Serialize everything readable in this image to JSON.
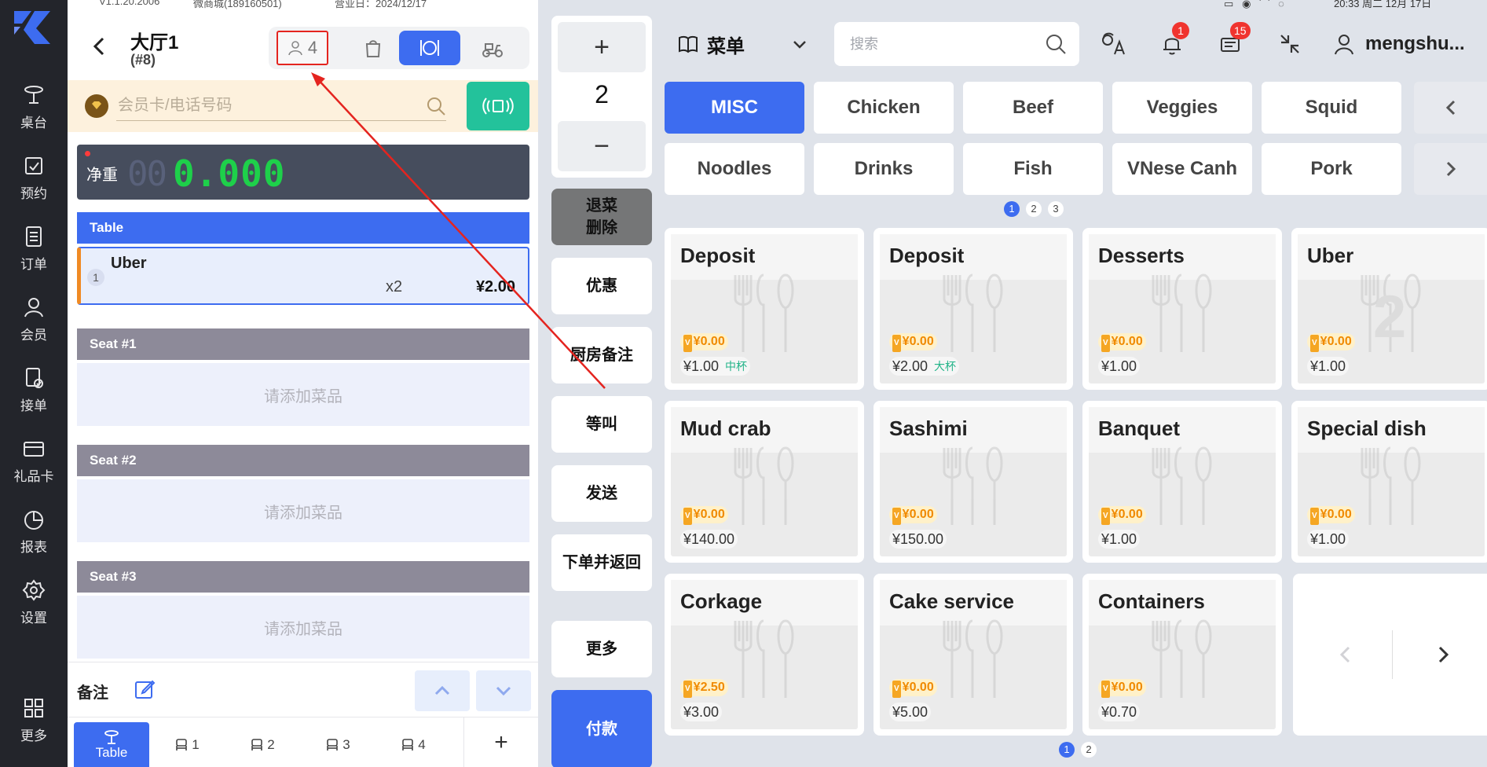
{
  "status": {
    "left_version": "V1.1.20.2006",
    "left_store": "微商城(189160501)",
    "left_business_day": "营业日：2024/12/17",
    "right_time": "20:33 周二 12月 17日"
  },
  "sidebar": {
    "items": [
      {
        "label": "桌台",
        "icon": "table-icon"
      },
      {
        "label": "预约",
        "icon": "calendar-check-icon"
      },
      {
        "label": "订单",
        "icon": "order-list-icon"
      },
      {
        "label": "会员",
        "icon": "member-icon"
      },
      {
        "label": "接单",
        "icon": "receive-order-icon"
      },
      {
        "label": "礼品卡",
        "icon": "gift-card-icon"
      },
      {
        "label": "报表",
        "icon": "pie-chart-icon"
      },
      {
        "label": "设置",
        "icon": "gear-icon"
      },
      {
        "label": "更多",
        "icon": "grid-icon"
      }
    ]
  },
  "order": {
    "title": "大厅1",
    "number": "(#8)",
    "guests": "4",
    "modes": [
      "guest-count-icon",
      "takeaway-bag-icon",
      "dine-in-icon",
      "delivery-scooter-icon"
    ],
    "member_placeholder": "会员卡/电话号码",
    "scale": {
      "label": "净重",
      "ghost": "00",
      "value": "0.000"
    },
    "table_section": "Table",
    "line": {
      "index": "1",
      "name": "Uber",
      "qty": "x2",
      "price": "¥2.00"
    },
    "seats": [
      {
        "header": "Seat #1",
        "empty": "请添加菜品"
      },
      {
        "header": "Seat #2",
        "empty": "请添加菜品"
      },
      {
        "header": "Seat #3",
        "empty": "请添加菜品"
      }
    ],
    "remark_label": "备注",
    "seat_tabs": [
      {
        "label": "Table"
      },
      {
        "label": "1"
      },
      {
        "label": "2"
      },
      {
        "label": "3"
      },
      {
        "label": "4"
      }
    ],
    "add_seat": "+"
  },
  "actions": {
    "plus": "+",
    "qty": "2",
    "minus": "−",
    "return_delete": [
      "退菜",
      "删除"
    ],
    "discount": "优惠",
    "kitchen_note": "厨房备注",
    "wait_call": "等叫",
    "send": "发送",
    "order_return": "下单并返回",
    "more": "更多",
    "pay": "付款"
  },
  "menu": {
    "selector_label": "菜单",
    "search_placeholder": "搜索",
    "notification_badge": "1",
    "order_badge": "15",
    "username": "mengshu...",
    "categories_row1": [
      "MISC",
      "Chicken",
      "Beef",
      "Veggies",
      "Squid"
    ],
    "categories_row2": [
      "Noodles",
      "Drinks",
      "Fish",
      "VNese Canh",
      "Pork"
    ],
    "active_category": "MISC",
    "category_pages": [
      "1",
      "2",
      "3"
    ],
    "dishes": [
      {
        "name": "Deposit",
        "promo": "¥0.00",
        "price": "¥1.00",
        "tag": "中杯"
      },
      {
        "name": "Deposit",
        "promo": "¥0.00",
        "price": "¥2.00",
        "tag": "大杯"
      },
      {
        "name": "Desserts",
        "promo": "¥0.00",
        "price": "¥1.00",
        "tag": ""
      },
      {
        "name": "Uber",
        "promo": "¥0.00",
        "price": "¥1.00",
        "tag": "",
        "count": "2"
      },
      {
        "name": "Mud crab",
        "promo": "¥0.00",
        "price": "¥140.00",
        "tag": ""
      },
      {
        "name": "Sashimi",
        "promo": "¥0.00",
        "price": "¥150.00",
        "tag": ""
      },
      {
        "name": "Banquet",
        "promo": "¥0.00",
        "price": "¥1.00",
        "tag": ""
      },
      {
        "name": "Special dish",
        "promo": "¥0.00",
        "price": "¥1.00",
        "tag": ""
      },
      {
        "name": "Corkage",
        "promo": "¥2.50",
        "price": "¥3.00",
        "tag": ""
      },
      {
        "name": "Cake service",
        "promo": "¥0.00",
        "price": "¥5.00",
        "tag": ""
      },
      {
        "name": "Containers",
        "promo": "¥0.00",
        "price": "¥0.70",
        "tag": ""
      }
    ],
    "dish_pages": [
      "1",
      "2"
    ],
    "promo_icon": "V"
  },
  "colors": {
    "accent": "#3d6cf0",
    "sidebar": "#23252b",
    "nfc": "#23c29b",
    "scale_digits": "#1ed04a",
    "annotation": "#e4241f"
  }
}
